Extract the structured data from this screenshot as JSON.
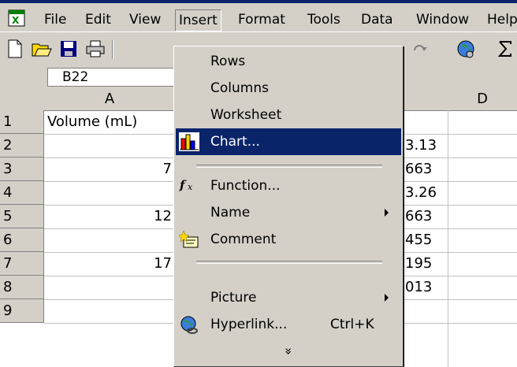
{
  "menubar": {
    "items": [
      "File",
      "Edit",
      "View",
      "Insert",
      "Format",
      "Tools",
      "Data",
      "Window",
      "Help"
    ],
    "active_index": 3
  },
  "namebox": {
    "value": "B22"
  },
  "columns": [
    "A",
    "D"
  ],
  "rows": [
    "1",
    "2",
    "3",
    "4",
    "5",
    "6",
    "7",
    "8",
    "9"
  ],
  "cells": {
    "A1": "Volume (mL)",
    "A3": "7",
    "A4": "",
    "A5": "12",
    "A6": "",
    "A7": "17",
    "A8": "",
    "C2": "3.13",
    "C3": "663",
    "C4": "3.26",
    "C5": "663",
    "C6": "455",
    "C7": "195",
    "C8": "013"
  },
  "insert_menu": {
    "rows": "Rows",
    "columns": "Columns",
    "worksheet": "Worksheet",
    "chart": "Chart...",
    "function": "Function...",
    "name": "Name",
    "comment": "Comment",
    "picture": "Picture",
    "hyperlink": "Hyperlink...",
    "hyperlink_shortcut": "Ctrl+K",
    "expand": "»"
  },
  "colors": {
    "highlight": "#0a246a",
    "face": "#d4d0c8"
  }
}
